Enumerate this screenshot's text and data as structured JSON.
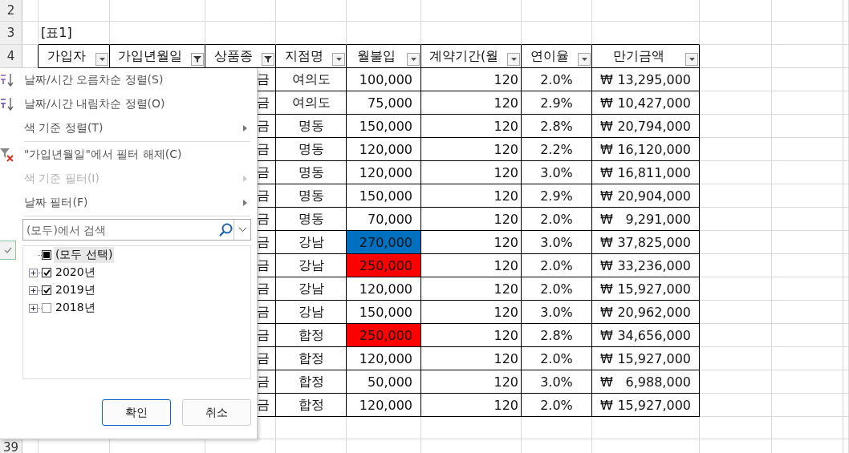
{
  "row_numbers": [
    "2",
    "3",
    "4",
    "39"
  ],
  "table_caption": "[표1]",
  "columns": [
    {
      "label": "가입자",
      "filtered": false
    },
    {
      "label": "가입년월일",
      "filtered": true
    },
    {
      "label": "상품종",
      "filtered": true
    },
    {
      "label": "지점명",
      "filtered": false
    },
    {
      "label": "월불입",
      "filtered": false
    },
    {
      "label": "계약기간(월",
      "filtered": false
    },
    {
      "label": "연이율",
      "filtered": false
    },
    {
      "label": "만기금액",
      "filtered": false
    }
  ],
  "rows": [
    {
      "product": "금",
      "branch": "여의도",
      "monthly": "100,000",
      "term": "120",
      "rate": "2.0%",
      "currency": "₩",
      "amount": "13,295,000"
    },
    {
      "product": "금",
      "branch": "여의도",
      "monthly": "75,000",
      "term": "120",
      "rate": "2.9%",
      "currency": "₩",
      "amount": "10,427,000"
    },
    {
      "product": "금",
      "branch": "명동",
      "monthly": "150,000",
      "term": "120",
      "rate": "2.8%",
      "currency": "₩",
      "amount": "20,794,000"
    },
    {
      "product": "금",
      "branch": "명동",
      "monthly": "120,000",
      "term": "120",
      "rate": "2.2%",
      "currency": "₩",
      "amount": "16,120,000"
    },
    {
      "product": "금",
      "branch": "명동",
      "monthly": "120,000",
      "term": "120",
      "rate": "3.0%",
      "currency": "₩",
      "amount": "16,811,000"
    },
    {
      "product": "금",
      "branch": "명동",
      "monthly": "150,000",
      "term": "120",
      "rate": "2.9%",
      "currency": "₩",
      "amount": "20,904,000"
    },
    {
      "product": "금",
      "branch": "명동",
      "monthly": "70,000",
      "term": "120",
      "rate": "2.0%",
      "currency": "₩",
      "amount": "9,291,000"
    },
    {
      "product": "금",
      "branch": "강남",
      "monthly": "270,000",
      "color": "#0070c0",
      "term": "120",
      "rate": "3.0%",
      "currency": "₩",
      "amount": "37,825,000"
    },
    {
      "product": "금",
      "branch": "강남",
      "monthly": "250,000",
      "color": "#ff0000",
      "term": "120",
      "rate": "2.0%",
      "currency": "₩",
      "amount": "33,236,000"
    },
    {
      "product": "금",
      "branch": "강남",
      "monthly": "120,000",
      "term": "120",
      "rate": "2.0%",
      "currency": "₩",
      "amount": "15,927,000"
    },
    {
      "product": "금",
      "branch": "강남",
      "monthly": "150,000",
      "term": "120",
      "rate": "3.0%",
      "currency": "₩",
      "amount": "20,962,000"
    },
    {
      "product": "금",
      "branch": "합정",
      "monthly": "250,000",
      "color": "#ff0000",
      "term": "120",
      "rate": "2.8%",
      "currency": "₩",
      "amount": "34,656,000"
    },
    {
      "product": "금",
      "branch": "합정",
      "monthly": "120,000",
      "term": "120",
      "rate": "2.0%",
      "currency": "₩",
      "amount": "15,927,000"
    },
    {
      "product": "금",
      "branch": "합정",
      "monthly": "50,000",
      "term": "120",
      "rate": "3.0%",
      "currency": "₩",
      "amount": "6,988,000"
    },
    {
      "product": "금",
      "branch": "합정",
      "monthly": "120,000",
      "term": "120",
      "rate": "2.0%",
      "currency": "₩",
      "amount": "15,927,000"
    }
  ],
  "filter_menu": {
    "items": [
      {
        "kind": "sort_asc",
        "label": "날짜/시간 오름차순 정렬(S)",
        "disabled": false
      },
      {
        "kind": "sort_desc",
        "label": "날짜/시간 내림차순 정렬(O)",
        "disabled": false
      },
      {
        "kind": "submenu",
        "label": "색 기준 정렬(T)",
        "disabled": false
      },
      {
        "kind": "separator"
      },
      {
        "kind": "clear_filter",
        "label": "\"가입년월일\"에서 필터 해제(C)",
        "disabled": false
      },
      {
        "kind": "submenu",
        "label": "색 기준 필터(I)",
        "disabled": true
      },
      {
        "kind": "submenu",
        "label": "날짜 필터(F)",
        "disabled": false
      },
      {
        "kind": "separator"
      }
    ],
    "search": {
      "placeholder": "(모두)에서 검색"
    },
    "tree": [
      {
        "kind": "all",
        "label": "(모두 선택)",
        "checked": true,
        "mixed": true,
        "selected": true
      },
      {
        "kind": "group",
        "label": "2020년",
        "checked": true,
        "selected": false,
        "expanded": false
      },
      {
        "kind": "group",
        "label": "2019년",
        "checked": true,
        "selected": false,
        "expanded": false
      },
      {
        "kind": "group",
        "label": "2018년",
        "checked": false,
        "selected": false,
        "expanded": false
      }
    ],
    "buttons": [
      {
        "label": "확인",
        "focused": true
      },
      {
        "label": "취소",
        "focused": false
      }
    ]
  }
}
